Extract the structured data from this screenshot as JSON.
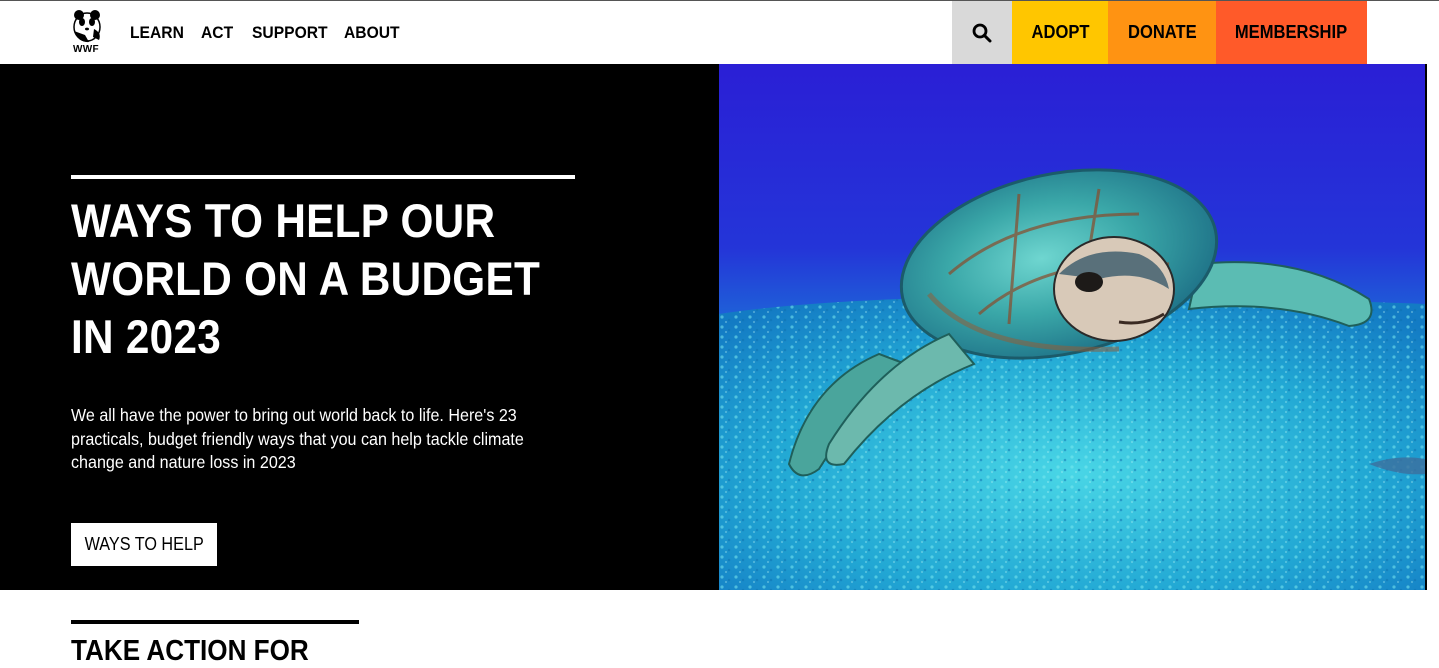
{
  "header": {
    "logo_text": "WWF",
    "logo_icon": "panda-logo-icon",
    "nav": [
      {
        "label": "LEARN"
      },
      {
        "label": "ACT"
      },
      {
        "label": "SUPPORT"
      },
      {
        "label": "ABOUT"
      }
    ],
    "search_icon": "search-icon",
    "adopt_label": "ADOPT",
    "donate_label": "DONATE",
    "membership_label": "MEMBERSHIP",
    "colors": {
      "search_bg": "#d9d9d9",
      "adopt_bg": "#ffc600",
      "donate_bg": "#ff9312",
      "membership_bg": "#ff5a29"
    }
  },
  "hero": {
    "title": "WAYS TO HELP OUR WORLD ON A BUDGET IN 2023",
    "description": "We all have the power to bring out world back to life. Here's 23 practicals, budget friendly ways that you can help tackle climate change and nature loss in 2023",
    "cta_label": "WAYS TO HELP",
    "image": "sea-turtle-photo"
  },
  "section": {
    "title": "TAKE ACTION FOR"
  }
}
